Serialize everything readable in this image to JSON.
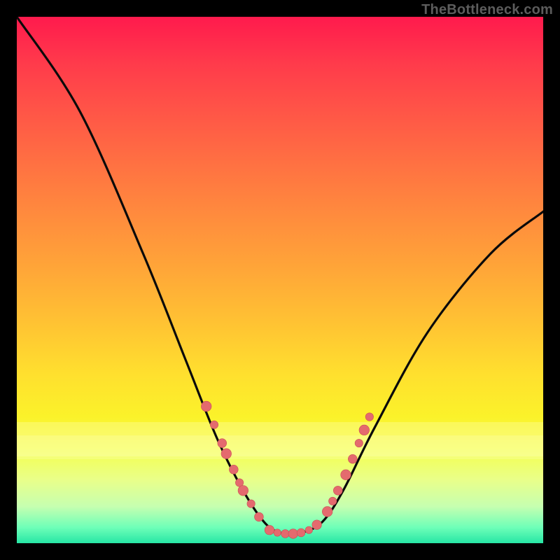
{
  "watermark": "TheBottleneck.com",
  "colors": {
    "frame": "#000000",
    "curve_stroke": "#0a0a0a",
    "marker_fill": "#e46a6e",
    "marker_stroke": "#c94f53"
  },
  "chart_data": {
    "type": "line",
    "title": "",
    "xlabel": "",
    "ylabel": "",
    "xlim": [
      0,
      100
    ],
    "ylim": [
      0,
      100
    ],
    "grid": false,
    "curve": [
      {
        "x": 0,
        "y": 100
      },
      {
        "x": 12,
        "y": 82
      },
      {
        "x": 24,
        "y": 55
      },
      {
        "x": 32,
        "y": 35
      },
      {
        "x": 38,
        "y": 20
      },
      {
        "x": 43,
        "y": 10
      },
      {
        "x": 47,
        "y": 4
      },
      {
        "x": 50,
        "y": 2
      },
      {
        "x": 54,
        "y": 2
      },
      {
        "x": 58,
        "y": 4
      },
      {
        "x": 62,
        "y": 10
      },
      {
        "x": 68,
        "y": 22
      },
      {
        "x": 78,
        "y": 40
      },
      {
        "x": 90,
        "y": 55
      },
      {
        "x": 100,
        "y": 63
      }
    ],
    "markers_left": [
      {
        "x": 36.0,
        "y": 26.0
      },
      {
        "x": 37.5,
        "y": 22.5
      },
      {
        "x": 39.0,
        "y": 19.0
      },
      {
        "x": 39.8,
        "y": 17.0
      },
      {
        "x": 41.2,
        "y": 14.0
      },
      {
        "x": 42.3,
        "y": 11.5
      },
      {
        "x": 43.0,
        "y": 10.0
      },
      {
        "x": 44.5,
        "y": 7.5
      },
      {
        "x": 46.0,
        "y": 5.0
      }
    ],
    "markers_bottom": [
      {
        "x": 48.0,
        "y": 2.5
      },
      {
        "x": 49.5,
        "y": 2.0
      },
      {
        "x": 51.0,
        "y": 1.8
      },
      {
        "x": 52.5,
        "y": 1.8
      },
      {
        "x": 54.0,
        "y": 2.0
      },
      {
        "x": 55.5,
        "y": 2.5
      },
      {
        "x": 57.0,
        "y": 3.5
      }
    ],
    "markers_right": [
      {
        "x": 59.0,
        "y": 6.0
      },
      {
        "x": 60.0,
        "y": 8.0
      },
      {
        "x": 61.0,
        "y": 10.0
      },
      {
        "x": 62.5,
        "y": 13.0
      },
      {
        "x": 63.8,
        "y": 16.0
      },
      {
        "x": 65.0,
        "y": 19.0
      },
      {
        "x": 66.0,
        "y": 21.5
      },
      {
        "x": 67.0,
        "y": 24.0
      }
    ]
  }
}
